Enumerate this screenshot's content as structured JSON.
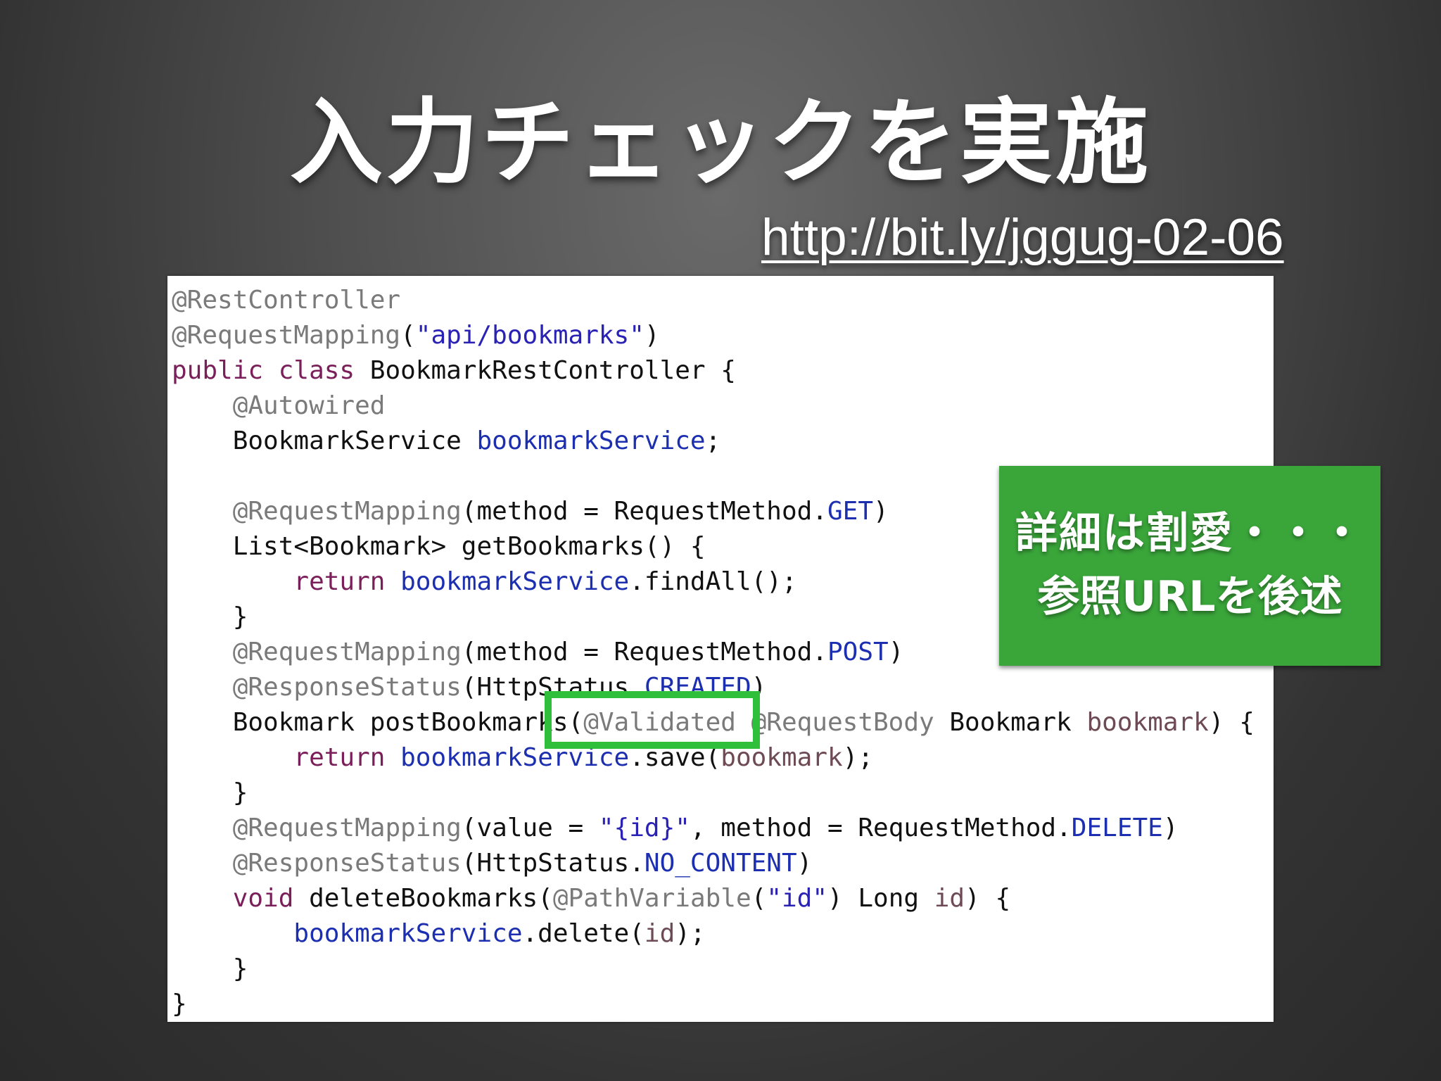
{
  "slide": {
    "title": "入力チェックを実施",
    "link": "http://bit.ly/jggug-02-06"
  },
  "code": {
    "lines": [
      [
        {
          "t": "ann",
          "v": "@RestController"
        }
      ],
      [
        {
          "t": "ann",
          "v": "@RequestMapping"
        },
        {
          "t": "txt",
          "v": "("
        },
        {
          "t": "str",
          "v": "\"api/bookmarks\""
        },
        {
          "t": "txt",
          "v": ")"
        }
      ],
      [
        {
          "t": "kw",
          "v": "public class"
        },
        {
          "t": "txt",
          "v": " BookmarkRestController {"
        }
      ],
      [
        {
          "t": "txt",
          "v": "    "
        },
        {
          "t": "ann",
          "v": "@Autowired"
        }
      ],
      [
        {
          "t": "txt",
          "v": "    BookmarkService "
        },
        {
          "t": "fld",
          "v": "bookmarkService"
        },
        {
          "t": "txt",
          "v": ";"
        }
      ],
      [
        {
          "t": "txt",
          "v": ""
        }
      ],
      [
        {
          "t": "txt",
          "v": "    "
        },
        {
          "t": "ann",
          "v": "@RequestMapping"
        },
        {
          "t": "txt",
          "v": "(method = RequestMethod."
        },
        {
          "t": "fld",
          "v": "GET"
        },
        {
          "t": "txt",
          "v": ")"
        }
      ],
      [
        {
          "t": "txt",
          "v": "    List<Bookmark> getBookmarks() {"
        }
      ],
      [
        {
          "t": "txt",
          "v": "        "
        },
        {
          "t": "kw",
          "v": "return"
        },
        {
          "t": "txt",
          "v": " "
        },
        {
          "t": "fld",
          "v": "bookmarkService"
        },
        {
          "t": "txt",
          "v": ".findAll();"
        }
      ],
      [
        {
          "t": "txt",
          "v": "    }"
        }
      ],
      [
        {
          "t": "txt",
          "v": "    "
        },
        {
          "t": "ann",
          "v": "@RequestMapping"
        },
        {
          "t": "txt",
          "v": "(method = RequestMethod."
        },
        {
          "t": "fld",
          "v": "POST"
        },
        {
          "t": "txt",
          "v": ")"
        }
      ],
      [
        {
          "t": "txt",
          "v": "    "
        },
        {
          "t": "ann",
          "v": "@ResponseStatus"
        },
        {
          "t": "txt",
          "v": "(HttpStatus."
        },
        {
          "t": "fld",
          "v": "CREATED"
        },
        {
          "t": "txt",
          "v": ")"
        }
      ],
      [
        {
          "t": "txt",
          "v": "    Bookmark postBookmarks("
        },
        {
          "t": "ann",
          "v": "@Validated @RequestBody"
        },
        {
          "t": "txt",
          "v": " Bookmark "
        },
        {
          "t": "par",
          "v": "bookmark"
        },
        {
          "t": "txt",
          "v": ") {"
        }
      ],
      [
        {
          "t": "txt",
          "v": "        "
        },
        {
          "t": "kw",
          "v": "return"
        },
        {
          "t": "txt",
          "v": " "
        },
        {
          "t": "fld",
          "v": "bookmarkService"
        },
        {
          "t": "txt",
          "v": ".save("
        },
        {
          "t": "par",
          "v": "bookmark"
        },
        {
          "t": "txt",
          "v": ");"
        }
      ],
      [
        {
          "t": "txt",
          "v": "    }"
        }
      ],
      [
        {
          "t": "txt",
          "v": "    "
        },
        {
          "t": "ann",
          "v": "@RequestMapping"
        },
        {
          "t": "txt",
          "v": "(value = "
        },
        {
          "t": "str",
          "v": "\"{id}\""
        },
        {
          "t": "txt",
          "v": ", method = RequestMethod."
        },
        {
          "t": "fld",
          "v": "DELETE"
        },
        {
          "t": "txt",
          "v": ")"
        }
      ],
      [
        {
          "t": "txt",
          "v": "    "
        },
        {
          "t": "ann",
          "v": "@ResponseStatus"
        },
        {
          "t": "txt",
          "v": "(HttpStatus."
        },
        {
          "t": "fld",
          "v": "NO_CONTENT"
        },
        {
          "t": "txt",
          "v": ")"
        }
      ],
      [
        {
          "t": "txt",
          "v": "    "
        },
        {
          "t": "kw",
          "v": "void"
        },
        {
          "t": "txt",
          "v": " deleteBookmarks("
        },
        {
          "t": "ann",
          "v": "@PathVariable"
        },
        {
          "t": "txt",
          "v": "("
        },
        {
          "t": "str",
          "v": "\"id\""
        },
        {
          "t": "txt",
          "v": ") Long "
        },
        {
          "t": "par",
          "v": "id"
        },
        {
          "t": "txt",
          "v": ") {"
        }
      ],
      [
        {
          "t": "txt",
          "v": "        "
        },
        {
          "t": "fld",
          "v": "bookmarkService"
        },
        {
          "t": "txt",
          "v": ".delete("
        },
        {
          "t": "par",
          "v": "id"
        },
        {
          "t": "txt",
          "v": ");"
        }
      ],
      [
        {
          "t": "txt",
          "v": "    }"
        }
      ],
      [
        {
          "t": "txt",
          "v": "}"
        }
      ]
    ]
  },
  "callout": {
    "line1": "詳細は割愛・・・",
    "line2": "参照URLを後述"
  },
  "colors": {
    "highlight_border": "#2fbf3a",
    "callout_bg": "#3aa63a",
    "annotation": "#7a7a7a",
    "keyword": "#7a1f5a",
    "string": "#2a22b5",
    "field": "#1c2fb0"
  }
}
